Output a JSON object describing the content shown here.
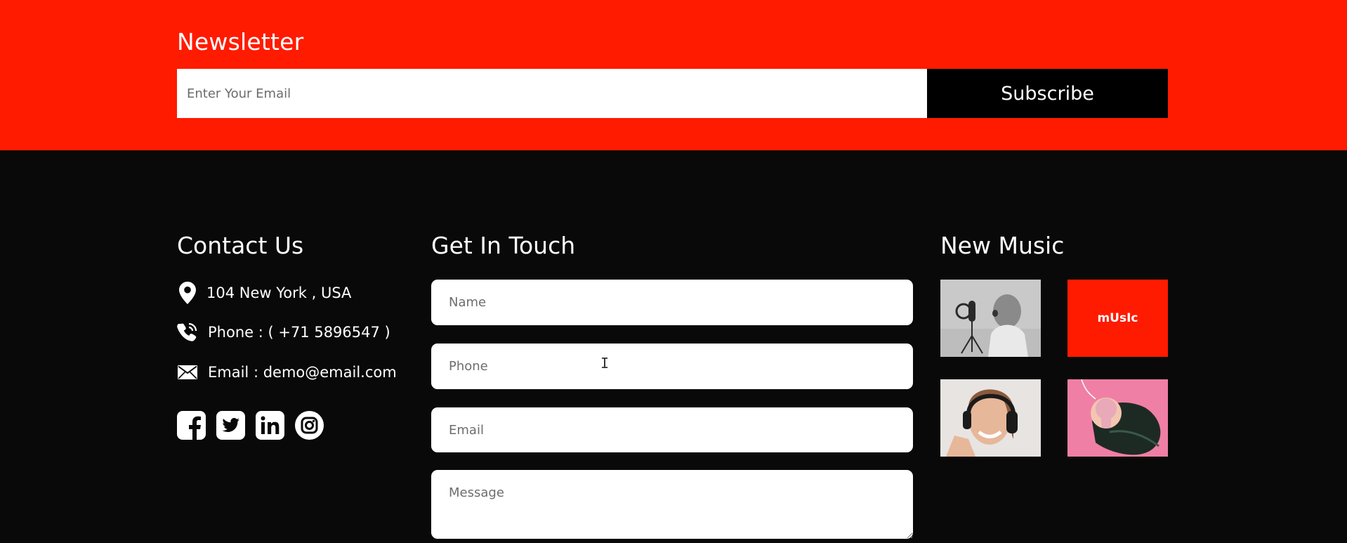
{
  "newsletter": {
    "title": "Newsletter",
    "email_placeholder": "Enter Your Email",
    "subscribe_label": "Subscribe"
  },
  "contact": {
    "title": "Contact Us",
    "address": "104 New York , USA",
    "phone": "Phone : ( +71 5896547 )",
    "email": "Email : demo@email.com",
    "social_icons": [
      "facebook-icon",
      "twitter-icon",
      "linkedin-icon",
      "instagram-icon"
    ]
  },
  "get_in_touch": {
    "title": "Get In Touch",
    "name_placeholder": "Name",
    "phone_placeholder": "Phone",
    "email_placeholder": "Email",
    "message_placeholder": "Message"
  },
  "new_music": {
    "title": "New Music",
    "tile_logo_text": "mUsIc"
  },
  "colors": {
    "accent_red": "#ff1b00",
    "footer_bg": "#0a0909",
    "button_bg": "#000000"
  }
}
